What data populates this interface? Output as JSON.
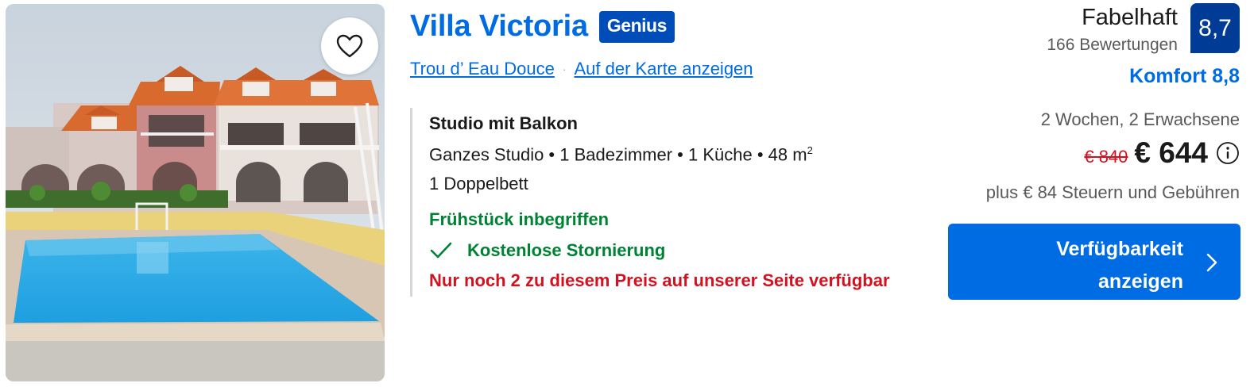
{
  "property": {
    "name": "Villa Victoria",
    "genius_badge": "Genius",
    "location_link": "Trou d’ Eau Douce",
    "separator": "·",
    "map_link": "Auf der Karte anzeigen"
  },
  "room": {
    "name": "Studio mit Balkon",
    "info": "Ganzes Studio • 1 Badezimmer • 1 Küche • 48 m",
    "info_sup": "2",
    "bed": "1 Doppelbett",
    "breakfast": "Frühstück inbegriffen",
    "cancellation": "Kostenlose Stornierung",
    "scarcity": "Nur noch 2 zu diesem Preis auf unserer Seite verfügbar"
  },
  "review": {
    "label": "Fabelhaft",
    "count": "166 Bewertungen",
    "score": "8,7",
    "comfort": "Komfort 8,8"
  },
  "pricing": {
    "stay": "2 Wochen, 2 Erwachsene",
    "old_price": "€ 840",
    "new_price": "€ 644",
    "taxes": "plus € 84 Steuern und Gebühren"
  },
  "cta": {
    "label": "Verfügbarkeit anzeigen"
  },
  "icons": {
    "favorite": "heart-icon",
    "check": "checkmark-icon",
    "info": "info-icon",
    "chevron": "chevron-right-icon"
  },
  "colors": {
    "brand_blue": "#006ce4",
    "dark_blue": "#003b95",
    "genius_blue": "#004cb8",
    "green": "#008234",
    "red": "#d4111e"
  }
}
